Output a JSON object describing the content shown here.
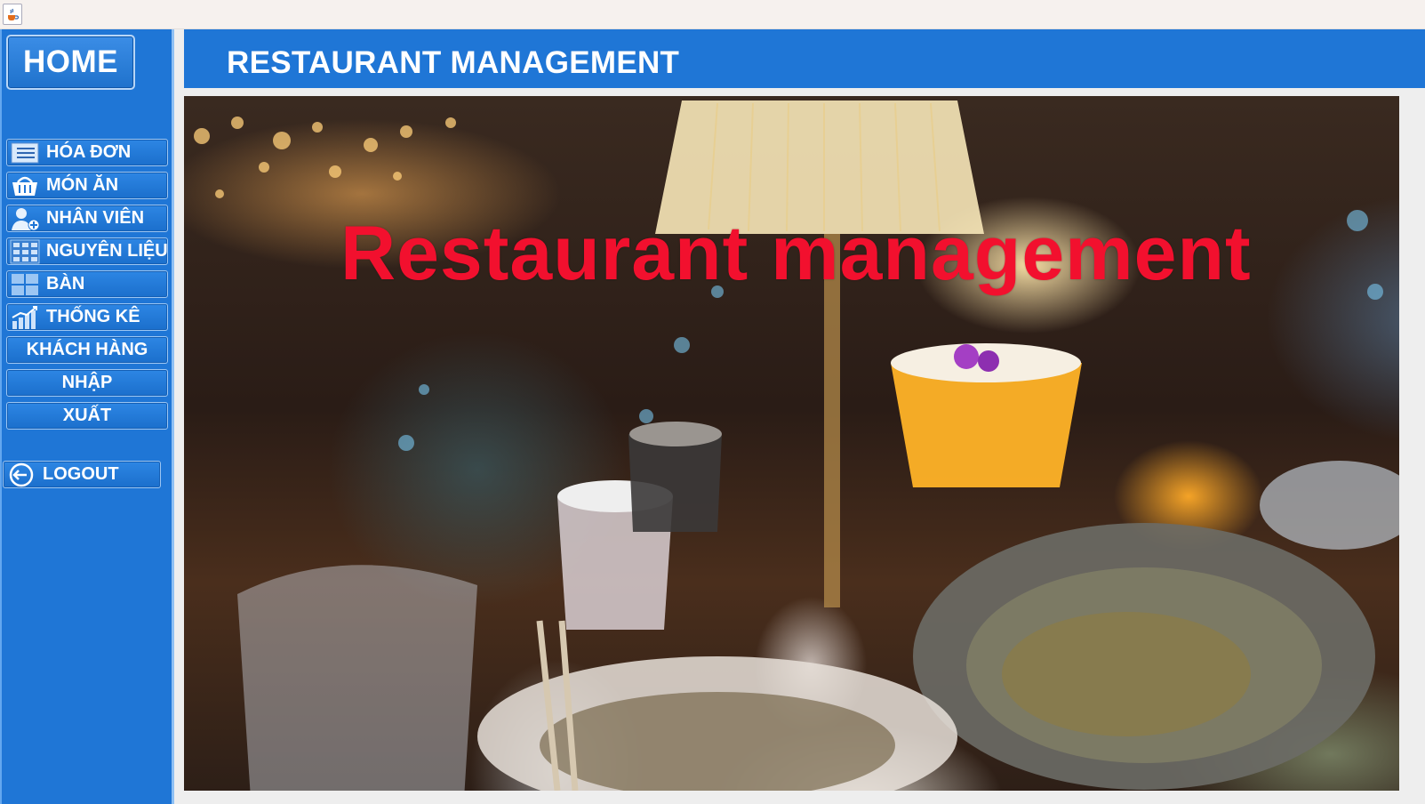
{
  "window": {
    "icon": "java-coffee-icon"
  },
  "sidebar": {
    "home_label": "HOME",
    "items": [
      {
        "label": "HÓA ĐƠN",
        "icon": "invoice-list-icon"
      },
      {
        "label": "MÓN ĂN",
        "icon": "basket-icon"
      },
      {
        "label": "NHÂN VIÊN",
        "icon": "add-employee-icon"
      },
      {
        "label": "NGUYÊN LIỆU",
        "icon": "ingredients-grid-icon"
      },
      {
        "label": "BÀN",
        "icon": "table-grid-icon"
      },
      {
        "label": "THỐNG KÊ",
        "icon": "bar-chart-icon"
      },
      {
        "label": "KHÁCH HÀNG"
      },
      {
        "label": "NHẬP"
      },
      {
        "label": "XUẤT"
      }
    ],
    "logout_label": "LOGOUT",
    "logout_icon": "logout-arrow-icon"
  },
  "header": {
    "title": "RESTAURANT MANAGEMENT"
  },
  "hero": {
    "overlay_text": "Restaurant management",
    "overlay_color": "#f2102e"
  },
  "colors": {
    "primary": "#1f76d6",
    "title_text": "#ffffff"
  }
}
